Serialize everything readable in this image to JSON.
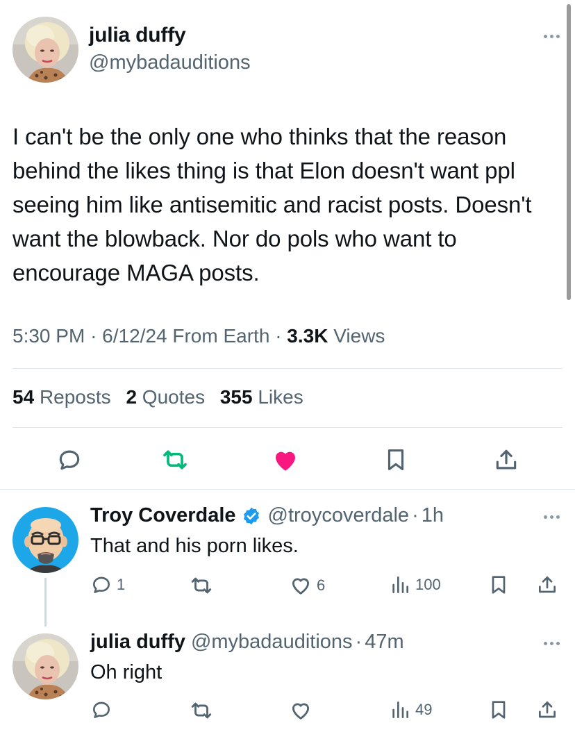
{
  "tweet": {
    "author_name": "julia duffy",
    "author_handle": "@mybadauditions",
    "text": "I can't be the only one who thinks that the reason behind the likes thing is that Elon doesn't want ppl seeing him like antisemitic and racist posts. Doesn't want the blowback.  Nor do pols who want to encourage MAGA posts.",
    "time": "5:30 PM",
    "date": "6/12/24",
    "source": "From Earth",
    "views_count": "3.3K",
    "views_label": "Views",
    "reposts_count": "54",
    "reposts_label": "Reposts",
    "quotes_count": "2",
    "quotes_label": "Quotes",
    "likes_count": "355",
    "likes_label": "Likes",
    "reposted": true,
    "liked": true
  },
  "replies": [
    {
      "author_name": "Troy Coverdale",
      "verified": true,
      "author_handle": "@troycoverdale",
      "time": "1h",
      "text": "That and his porn likes.",
      "reply_count": "1",
      "repost_count": "",
      "like_count": "6",
      "views_count": "100"
    },
    {
      "author_name": "julia duffy",
      "verified": false,
      "author_handle": "@mybadauditions",
      "time": "47m",
      "text": "Oh right",
      "reply_count": "",
      "repost_count": "",
      "like_count": "",
      "views_count": "49"
    }
  ],
  "separators": {
    "dot": "·"
  },
  "colors": {
    "text_primary": "#0f1419",
    "text_secondary": "#536471",
    "like_pink": "#f91880",
    "repost_green": "#00ba7c",
    "verified_blue": "#1d9bf0",
    "divider": "#e1e6ea"
  },
  "icons": {
    "main_actions": [
      "reply-icon",
      "repost-icon",
      "like-heart-icon",
      "bookmark-icon",
      "share-icon"
    ],
    "reply_actions": [
      "reply-icon",
      "repost-icon",
      "like-heart-icon",
      "views-bar-chart-icon",
      "bookmark-icon",
      "share-icon"
    ]
  }
}
